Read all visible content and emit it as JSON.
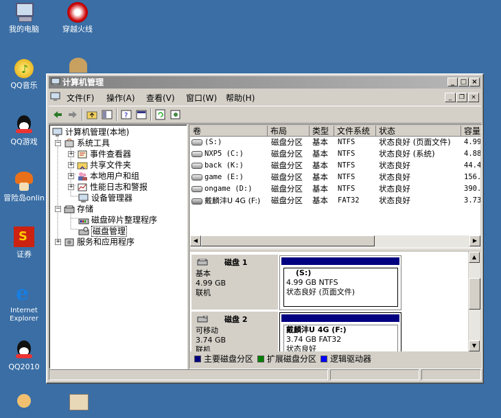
{
  "desktop": {
    "icons": [
      {
        "label": "我的电脑",
        "icon": "my-computer-icon"
      },
      {
        "label": "穿越火线",
        "icon": "crossfire-icon"
      },
      {
        "label": "QQ音乐",
        "icon": "qq-music-icon"
      },
      {
        "label": "QQ游戏",
        "icon": "qq-game-icon"
      },
      {
        "label": "冒险岛onlin",
        "icon": "maplestory-icon"
      },
      {
        "label": "证券",
        "icon": "stock-icon"
      },
      {
        "label": "Internet Explorer",
        "icon": "ie-icon"
      },
      {
        "label": "QQ2010",
        "icon": "qq-icon"
      }
    ]
  },
  "window": {
    "title": "计算机管理",
    "menu": [
      "文件(F)",
      "操作(A)",
      "查看(V)",
      "窗口(W)",
      "帮助(H)"
    ]
  },
  "tree": {
    "root": "计算机管理(本地)",
    "nodes": [
      {
        "label": "系统工具",
        "level": 1,
        "expander": "−"
      },
      {
        "label": "事件查看器",
        "level": 2,
        "expander": "+"
      },
      {
        "label": "共享文件夹",
        "level": 2,
        "expander": "+"
      },
      {
        "label": "本地用户和组",
        "level": 2,
        "expander": "+"
      },
      {
        "label": "性能日志和警报",
        "level": 2,
        "expander": "+"
      },
      {
        "label": "设备管理器",
        "level": 2,
        "expander": ""
      },
      {
        "label": "存储",
        "level": 1,
        "expander": "−"
      },
      {
        "label": "磁盘碎片整理程序",
        "level": 2,
        "expander": ""
      },
      {
        "label": "磁盘管理",
        "level": 2,
        "expander": "",
        "selected": true
      },
      {
        "label": "服务和应用程序",
        "level": 1,
        "expander": "+"
      }
    ]
  },
  "volumes": {
    "columns": [
      "卷",
      "布局",
      "类型",
      "文件系统",
      "状态",
      "容量"
    ],
    "rows": [
      {
        "volume": "(S:)",
        "layout": "磁盘分区",
        "type": "基本",
        "fs": "NTFS",
        "status": "状态良好 (页面文件)",
        "capacity": "4.99"
      },
      {
        "volume": "NXP5 (C:)",
        "layout": "磁盘分区",
        "type": "基本",
        "fs": "NTFS",
        "status": "状态良好 (系统)",
        "capacity": "4.88"
      },
      {
        "volume": "back (K:)",
        "layout": "磁盘分区",
        "type": "基本",
        "fs": "NTFS",
        "status": "状态良好",
        "capacity": "44.4"
      },
      {
        "volume": "game (E:)",
        "layout": "磁盘分区",
        "type": "基本",
        "fs": "NTFS",
        "status": "状态良好",
        "capacity": "156."
      },
      {
        "volume": "ongame (D:)",
        "layout": "磁盘分区",
        "type": "基本",
        "fs": "NTFS",
        "status": "状态良好",
        "capacity": "390."
      },
      {
        "volume": "戴麟沣U 4G (F:)",
        "layout": "磁盘分区",
        "type": "基本",
        "fs": "FAT32",
        "status": "状态良好",
        "capacity": "3.73"
      }
    ]
  },
  "disks": [
    {
      "name": "磁盘 1",
      "type": "基本",
      "size": "4.99 GB",
      "state": "联机",
      "partition": {
        "label": "(S:)",
        "detail": "4.99 GB NTFS",
        "status": "状态良好 (页面文件)"
      }
    },
    {
      "name": "磁盘 2",
      "type": "可移动",
      "size": "3.74 GB",
      "state": "联机",
      "partition": {
        "label": "戴麟沣U 4G  (F:)",
        "detail": "3.74 GB FAT32",
        "status": "状态良好"
      }
    }
  ],
  "legend": [
    {
      "label": "主要磁盘分区",
      "color": "#000080"
    },
    {
      "label": "扩展磁盘分区",
      "color": "#008000"
    },
    {
      "label": "逻辑驱动器",
      "color": "#0000ff"
    }
  ]
}
